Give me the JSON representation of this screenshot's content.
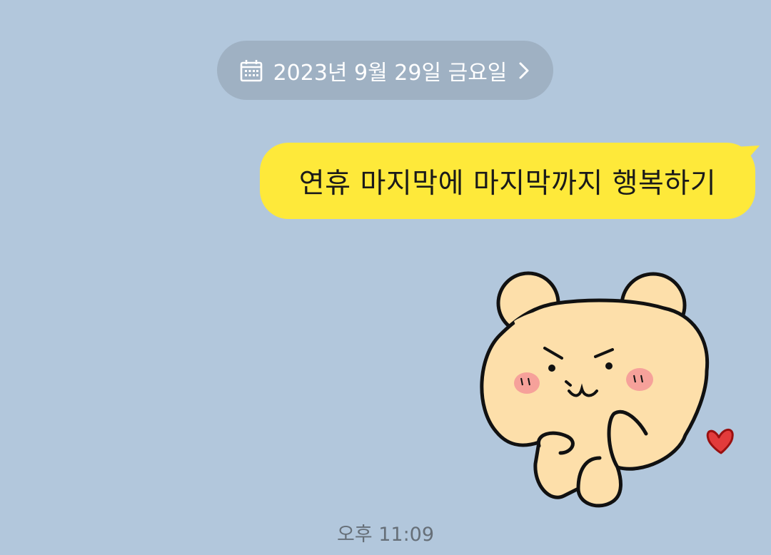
{
  "date_divider": {
    "label": "2023년 9월 29일 금요일",
    "icon": "calendar-icon",
    "trailing_icon": "chevron-right-icon"
  },
  "messages": [
    {
      "type": "text",
      "direction": "outgoing",
      "text": "연휴 마지막에 마지막까지 행복하기"
    },
    {
      "type": "sticker",
      "direction": "outgoing",
      "sticker": "bear-sticker",
      "time": "오후 11:09"
    }
  ],
  "colors": {
    "background": "#b2c7dc",
    "outgoing_bubble": "#fee93a",
    "date_pill": "#9fb1c3",
    "timestamp_text": "#666f78"
  }
}
